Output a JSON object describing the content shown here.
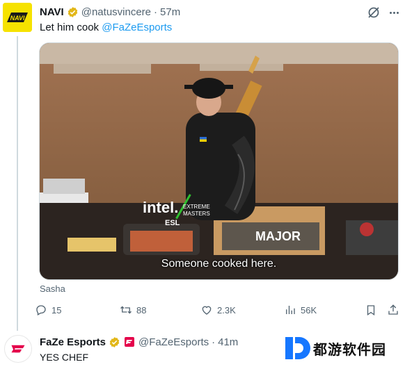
{
  "tweet": {
    "author_name": "NAVI",
    "author_handle": "@natusvincere",
    "separator": "·",
    "time": "57m",
    "text_prefix": "Let him cook ",
    "mention": "@FaZeEsports",
    "media": {
      "subtitle": "Someone cooked here.",
      "sponsor_logo_text": "intel.",
      "event_text_1": "EXTREME",
      "event_text_2": "MASTERS",
      "esl_text": "ESL",
      "major_text": "MAJOR"
    },
    "caption": "Sasha",
    "actions": {
      "replies": "15",
      "reposts": "88",
      "likes": "2.3K",
      "views": "56K"
    },
    "icons": [
      "grok-icon",
      "more-icon",
      "verified-badge-icon",
      "reply-icon",
      "repost-icon",
      "like-icon",
      "views-icon",
      "bookmark-icon",
      "share-icon"
    ]
  },
  "reply": {
    "author_name": "FaZe Esports",
    "author_handle": "@FaZeEsports",
    "separator": "·",
    "time": "41m",
    "text": "YES CHEF"
  },
  "watermark": {
    "text": "都游软件园"
  },
  "colors": {
    "text_primary": "#0f1419",
    "text_secondary": "#536471",
    "link": "#1d9bf0",
    "verified_gold": "#e2b719",
    "navi_yellow": "#f6e200",
    "faze_red": "#e4004b"
  }
}
